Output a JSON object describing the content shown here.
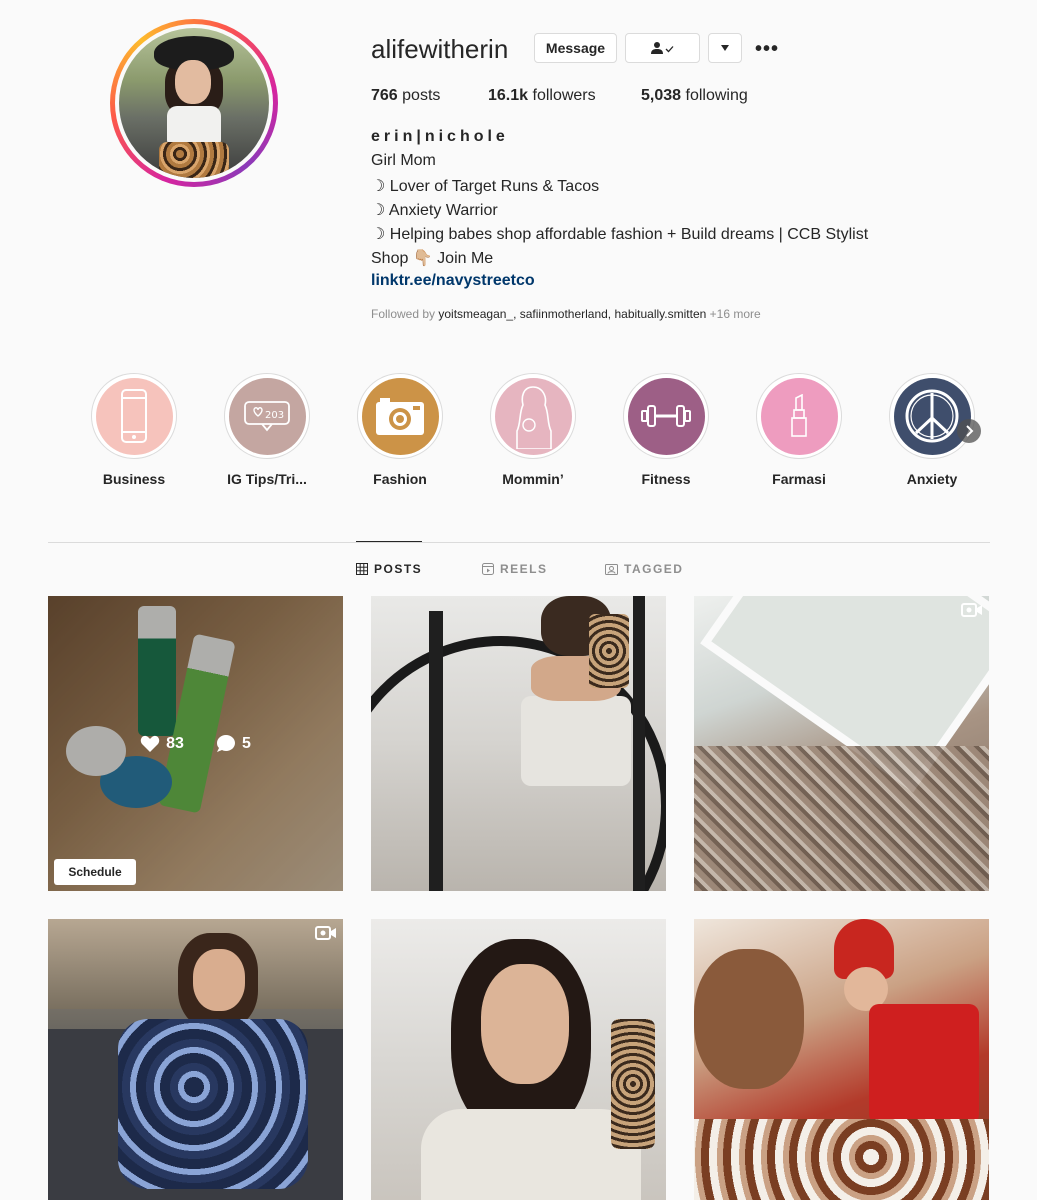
{
  "profile": {
    "username": "alifewitherin",
    "message_label": "Message",
    "more_label": "•••",
    "posts_count": "766",
    "posts_label": "posts",
    "followers_count": "16.1k",
    "followers_label": "followers",
    "following_count": "5,038",
    "following_label": "following"
  },
  "bio": {
    "full_name": "erin|nichole",
    "line1": "Girl Mom",
    "line2": "☽ Lover of Target Runs & Tacos",
    "line3": "☽ Anxiety Warrior",
    "line4": "☽ Helping babes shop affordable fashion + Build dreams | CCB Stylist",
    "line5": "Shop 👇🏼 Join Me",
    "link": "linktr.ee/navystreetco",
    "followed_prefix": "Followed by",
    "followed_names": "yoitsmeagan_, safiinmotherland, habitually.smitten",
    "followed_more": "+16 more"
  },
  "highlights": [
    {
      "label": "Business",
      "color": "#f6c3bc",
      "icon": "phone-icon"
    },
    {
      "label": "IG Tips/Tri...",
      "color": "#c4a6a1",
      "icon": "like-notification-icon"
    },
    {
      "label": "Fashion",
      "color": "#cc9347",
      "icon": "camera-icon"
    },
    {
      "label": "Mommin’",
      "color": "#e6b5c0",
      "icon": "mom-baby-icon"
    },
    {
      "label": "Fitness",
      "color": "#9d5f86",
      "icon": "dumbbell-icon"
    },
    {
      "label": "Farmasi",
      "color": "#ee9cbf",
      "icon": "lipstick-icon"
    },
    {
      "label": "Anxiety",
      "color": "#3f4e6c",
      "icon": "peace-icon"
    }
  ],
  "tabs": {
    "posts": "POSTS",
    "reels": "REELS",
    "tagged": "TAGGED"
  },
  "posts": {
    "first": {
      "likes": "83",
      "comments": "5",
      "schedule_label": "Schedule"
    }
  }
}
